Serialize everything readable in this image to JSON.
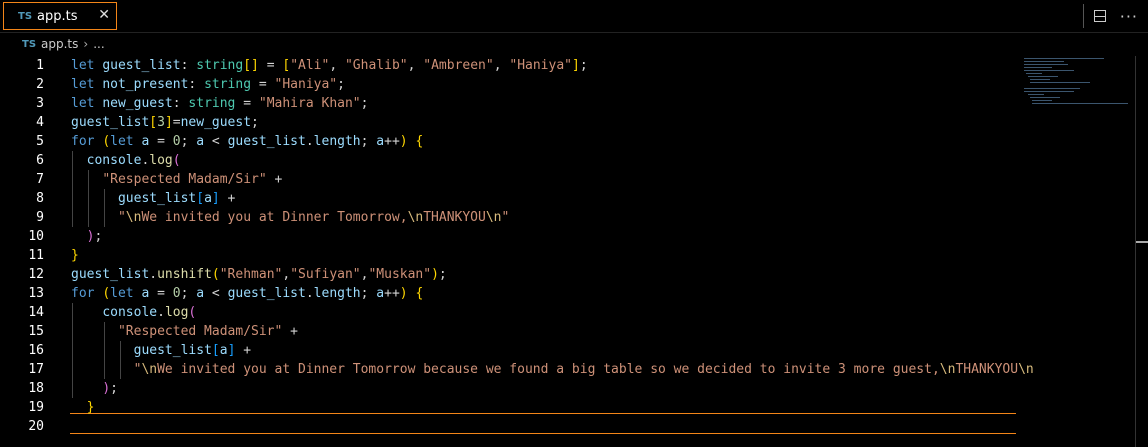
{
  "tab": {
    "badge": "TS",
    "name": "app.ts",
    "close": "✕"
  },
  "breadcrumb": {
    "badge": "TS",
    "file": "app.ts",
    "sep": "›",
    "more": "..."
  },
  "actions": {
    "more": "···"
  },
  "lines": [
    "1",
    "2",
    "3",
    "4",
    "5",
    "6",
    "7",
    "8",
    "9",
    "10",
    "11",
    "12",
    "13",
    "14",
    "15",
    "16",
    "17",
    "18",
    "19",
    "20"
  ]
}
